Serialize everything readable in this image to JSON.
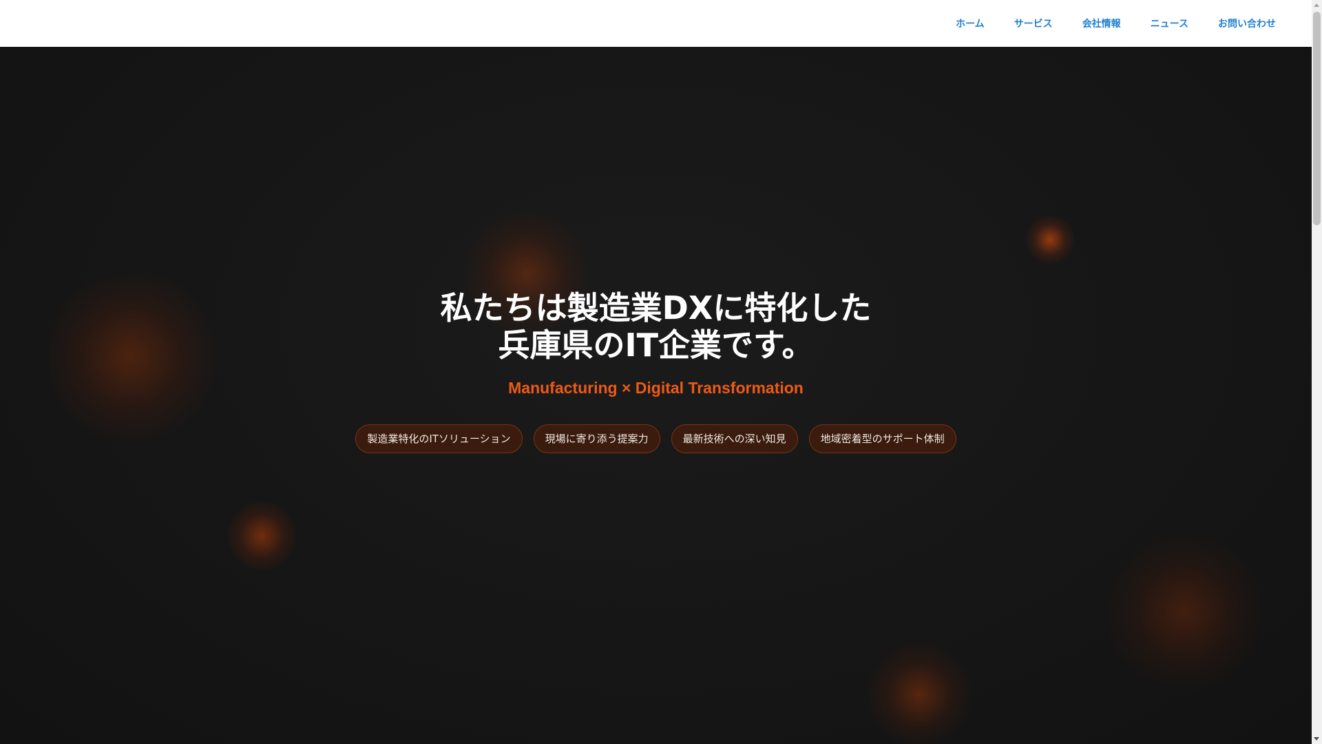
{
  "nav": {
    "items": [
      {
        "label": "ホーム"
      },
      {
        "label": "サービス"
      },
      {
        "label": "会社情報"
      },
      {
        "label": "ニュース"
      },
      {
        "label": "お問い合わせ"
      }
    ]
  },
  "hero": {
    "headline_line1": "私たちは製造業DXに特化した",
    "headline_line2": "兵庫県のIT企業です。",
    "subtitle": "Manufacturing × Digital Transformation",
    "tags": [
      {
        "label": "製造業特化のITソリューション"
      },
      {
        "label": "現場に寄り添う提案力"
      },
      {
        "label": "最新技術への深い知見"
      },
      {
        "label": "地域密着型のサポート体制"
      }
    ]
  },
  "colors": {
    "nav_link": "#1f7fd1",
    "accent": "#ee5a17",
    "hero_background": "#151515",
    "tag_border": "#7a3413"
  }
}
